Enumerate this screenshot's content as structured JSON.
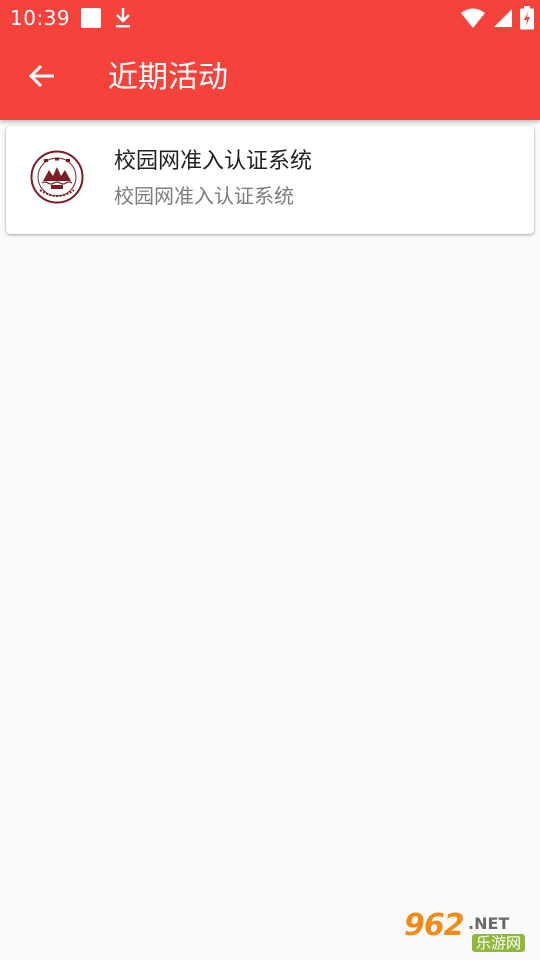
{
  "status_bar": {
    "time": "10:39",
    "left_icons": [
      "notification-square-icon",
      "download-icon"
    ],
    "right_icons": [
      "wifi-icon",
      "cell-signal-icon",
      "battery-charging-icon"
    ],
    "background": "#f5433c"
  },
  "app_bar": {
    "title": "近期活动",
    "back_icon": "arrow-back-icon",
    "background": "#f5433c"
  },
  "list": {
    "items": [
      {
        "title": "校园网准入认证系统",
        "subtitle": "校园网准入认证系统",
        "logo": "university-seal-icon"
      }
    ]
  },
  "watermark": {
    "brand_number": "962",
    "brand_tld": ".NET",
    "brand_sub": "乐游网"
  }
}
